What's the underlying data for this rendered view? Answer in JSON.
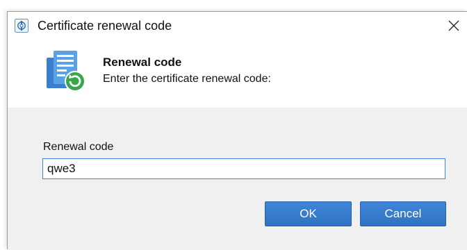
{
  "window": {
    "title": "Certificate renewal code",
    "icon": "app-logo-icon",
    "close_icon": "close-icon"
  },
  "header": {
    "icon": "certificate-renew-icon",
    "heading": "Renewal code",
    "subheading": "Enter the certificate renewal code:"
  },
  "form": {
    "label": "Renewal code",
    "value": "qwe3"
  },
  "buttons": {
    "ok": "OK",
    "cancel": "Cancel"
  },
  "colors": {
    "accent": "#2f72c3",
    "input_border": "#3c83d6",
    "panel_bg": "#f0f0f0"
  }
}
